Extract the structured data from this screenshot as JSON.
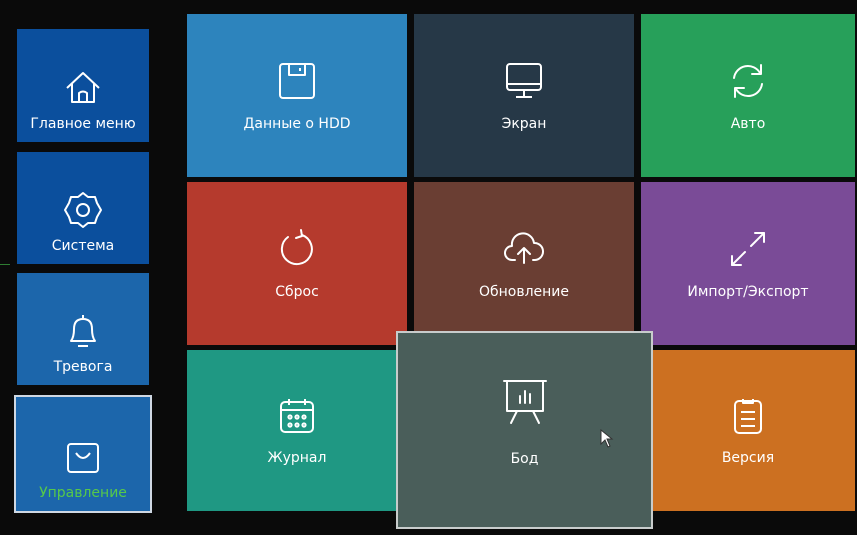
{
  "sidebar": {
    "items": [
      {
        "label": "Главное меню",
        "icon": "home-icon"
      },
      {
        "label": "Система",
        "icon": "gear-icon"
      },
      {
        "label": "Тревога",
        "icon": "bell-icon"
      },
      {
        "label": "Управление",
        "icon": "bag-icon",
        "selected": true
      }
    ]
  },
  "tiles": {
    "hdd": {
      "label": "Данные о HDD",
      "icon": "floppy-disk-icon"
    },
    "screen": {
      "label": "Экран",
      "icon": "monitor-icon"
    },
    "auto": {
      "label": "Авто",
      "icon": "refresh-icon"
    },
    "reset": {
      "label": "Сброс",
      "icon": "reset-icon"
    },
    "update": {
      "label": "Обновление",
      "icon": "cloud-upload-icon"
    },
    "import_export": {
      "label": "Импорт/Экспорт",
      "icon": "expand-arrows-icon"
    },
    "log": {
      "label": "Журнал",
      "icon": "calendar-icon"
    },
    "baud": {
      "label": "Бод",
      "icon": "presentation-chart-icon",
      "hovered": true
    },
    "version": {
      "label": "Версия",
      "icon": "clipboard-icon"
    }
  },
  "colors": {
    "sidebar_active": "#0b4f9d",
    "selected_label": "#56c94a",
    "hdd": "#2d84bd",
    "screen": "#263847",
    "auto": "#27a05a",
    "reset": "#b53a2d",
    "update": "#6a3e33",
    "import_export": "#7a4b97",
    "log": "#1f9883",
    "baud": "#4a5e5a",
    "version": "#cc7021"
  }
}
